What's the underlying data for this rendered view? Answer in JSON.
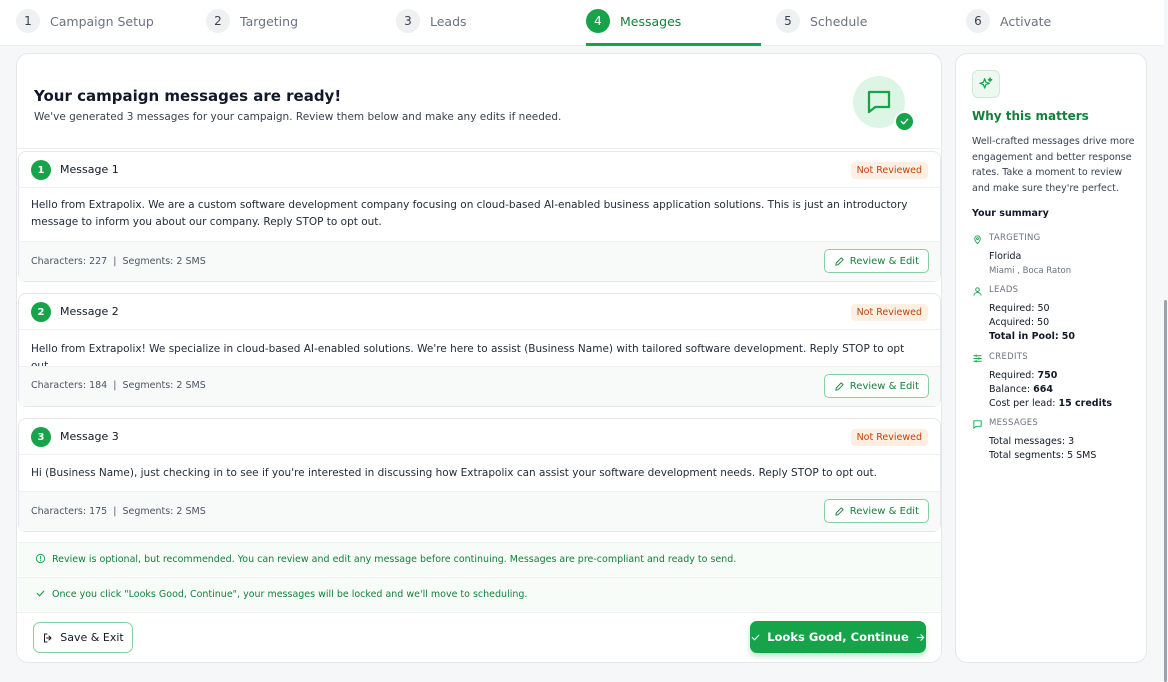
{
  "stepper": {
    "steps": [
      {
        "num": "1",
        "label": "Campaign Setup"
      },
      {
        "num": "2",
        "label": "Targeting"
      },
      {
        "num": "3",
        "label": "Leads"
      },
      {
        "num": "4",
        "label": "Messages"
      },
      {
        "num": "5",
        "label": "Schedule"
      },
      {
        "num": "6",
        "label": "Activate"
      }
    ],
    "active_index": 3
  },
  "hero": {
    "title": "Your campaign messages are ready!",
    "subtitle": "We've generated 3 messages for your campaign. Review them below and make any edits if needed."
  },
  "messages": [
    {
      "num": "1",
      "title": "Message 1",
      "status": "Not Reviewed",
      "body": "Hello from Extrapolix. We are a custom software development company focusing on cloud-based AI-enabled business application solutions. This is just an introductory message to inform you about our company. Reply STOP to opt out.",
      "meta": "Characters: 227  |  Segments: 2 SMS",
      "action": "Review & Edit"
    },
    {
      "num": "2",
      "title": "Message 2",
      "status": "Not Reviewed",
      "body": "Hello from Extrapolix! We specialize in cloud-based AI-enabled solutions. We're here to assist (Business Name) with tailored software development. Reply STOP to opt out.",
      "meta": "Characters: 184  |  Segments: 2 SMS",
      "action": "Review & Edit"
    },
    {
      "num": "3",
      "title": "Message 3",
      "status": "Not Reviewed",
      "body": "Hi (Business Name), just checking in to see if you're interested in discussing how Extrapolix can assist your software development needs. Reply STOP to opt out.",
      "meta": "Characters: 175  |  Segments: 2 SMS",
      "action": "Review & Edit"
    }
  ],
  "notes": {
    "review": "Review is optional, but recommended. You can review and edit any message before continuing. Messages are pre-compliant and ready to send.",
    "lock": "Once you click \"Looks Good, Continue\", your messages will be locked and we'll move to scheduling."
  },
  "footer": {
    "save_label": "Save & Exit",
    "continue_label": "Looks Good, Continue"
  },
  "side": {
    "title": "Why this matters",
    "description": "Well-crafted messages drive more engagement and better response rates. Take a moment to review and make sure they're perfect.",
    "summary_title": "Your summary",
    "targeting": {
      "heading": "TARGETING",
      "state": "Florida",
      "cities": "Miami , Boca Raton"
    },
    "leads": {
      "heading": "LEADS",
      "required_label": "Required:",
      "required": "50",
      "acquired_label": "Acquired:",
      "acquired": "50",
      "pool_label": "Total in Pool:",
      "pool": "50"
    },
    "credits": {
      "heading": "CREDITS",
      "required_label": "Required:",
      "required": "750",
      "balance_label": "Balance:",
      "balance": "664",
      "cost_label": "Cost per lead:",
      "cost": "15 credits"
    },
    "messages": {
      "heading": "MESSAGES",
      "total_label": "Total messages:",
      "total": "3",
      "segments_label": "Total segments:",
      "segments": "5 SMS"
    }
  },
  "colors": {
    "accent": "#16a34a",
    "accent_dark": "#15803d",
    "badge_bg": "#fdf0e3",
    "badge_text": "#c2410c"
  }
}
